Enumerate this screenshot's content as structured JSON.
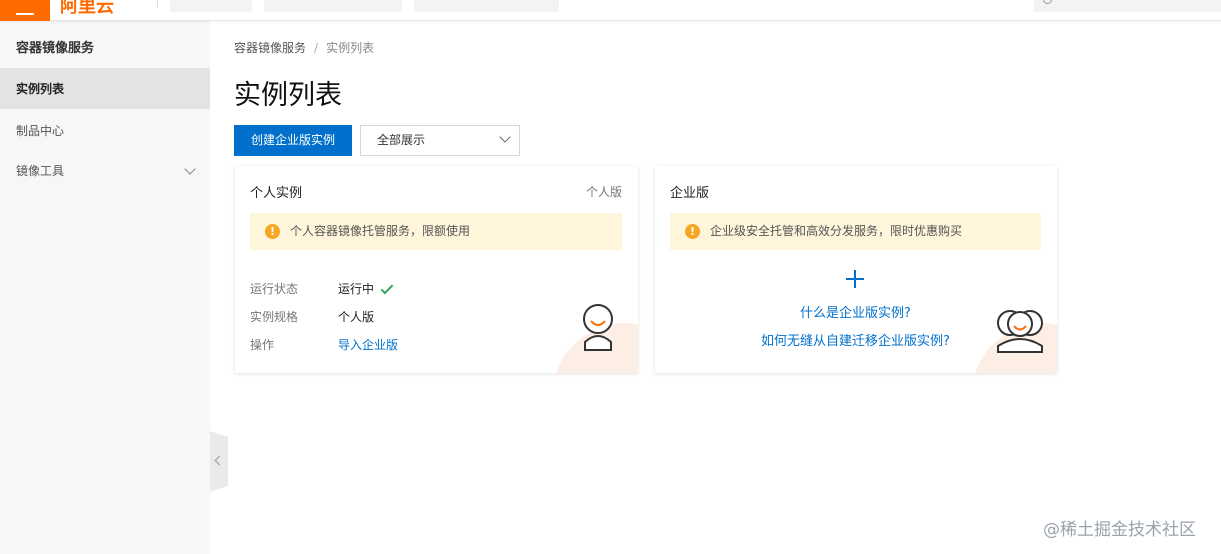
{
  "topbar": {
    "logo_text": "阿里云",
    "icons": [
      "menu-icon",
      "search-icon"
    ]
  },
  "sidebar": {
    "title": "容器镜像服务",
    "items": [
      {
        "label": "实例列表",
        "active": true
      },
      {
        "label": "制品中心",
        "active": false
      },
      {
        "label": "镜像工具",
        "active": false,
        "expandable": true
      }
    ]
  },
  "breadcrumb": {
    "items": [
      "容器镜像服务",
      "实例列表"
    ],
    "separator": "/"
  },
  "page": {
    "title": "实例列表",
    "create_button": "创建企业版实例",
    "filter_select": "全部展示"
  },
  "cards": {
    "personal": {
      "title": "个人实例",
      "tag": "个人版",
      "notice": "个人容器镜像托管服务，限额使用",
      "rows": [
        {
          "key": "运行状态",
          "value": "运行中"
        },
        {
          "key": "实例规格",
          "value": "个人版"
        },
        {
          "key": "操作",
          "value": "导入企业版"
        }
      ]
    },
    "enterprise": {
      "title": "企业版",
      "notice": "企业级安全托管和高效分发服务，限时优惠购买",
      "link1": "什么是企业版实例?",
      "link2": "如何无缝从自建迁移企业版实例?"
    }
  },
  "colors": {
    "brand_orange": "#ff6a00",
    "primary_blue": "#0070cc",
    "notice_bg": "#fff5db",
    "success_green": "#2fa85a"
  },
  "watermark": "@稀土掘金技术社区"
}
